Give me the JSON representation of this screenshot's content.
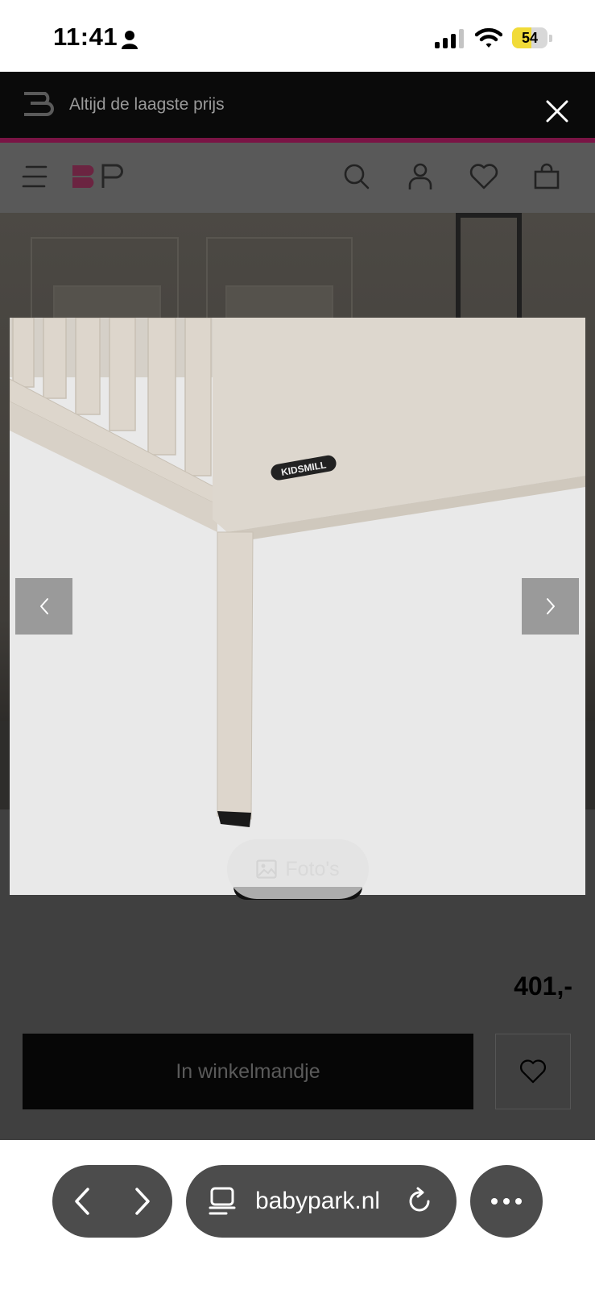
{
  "status_bar": {
    "time": "11:41",
    "battery": "54",
    "icons": [
      "person-icon",
      "signal-icon",
      "wifi-icon",
      "battery-icon"
    ]
  },
  "promo": {
    "text": "Altijd de laagste prijs",
    "accent_color": "#7a1445"
  },
  "header": {
    "brand": "BP",
    "brand_color": "#c0175d",
    "icons": [
      "menu-icon",
      "search-icon",
      "account-icon",
      "wishlist-icon",
      "cart-icon"
    ]
  },
  "lightbox": {
    "product_brand_label": "KIDSMILL",
    "photos_label": "Foto's",
    "icons": [
      "prev-arrow-icon",
      "next-arrow-icon",
      "image-icon",
      "close-icon"
    ]
  },
  "product": {
    "price": "401,-",
    "cart_button_label": "In winkelmandje"
  },
  "browser": {
    "url": "babypark.nl",
    "icons": [
      "back-icon",
      "forward-icon",
      "tabs-icon",
      "reload-icon",
      "more-icon"
    ]
  }
}
